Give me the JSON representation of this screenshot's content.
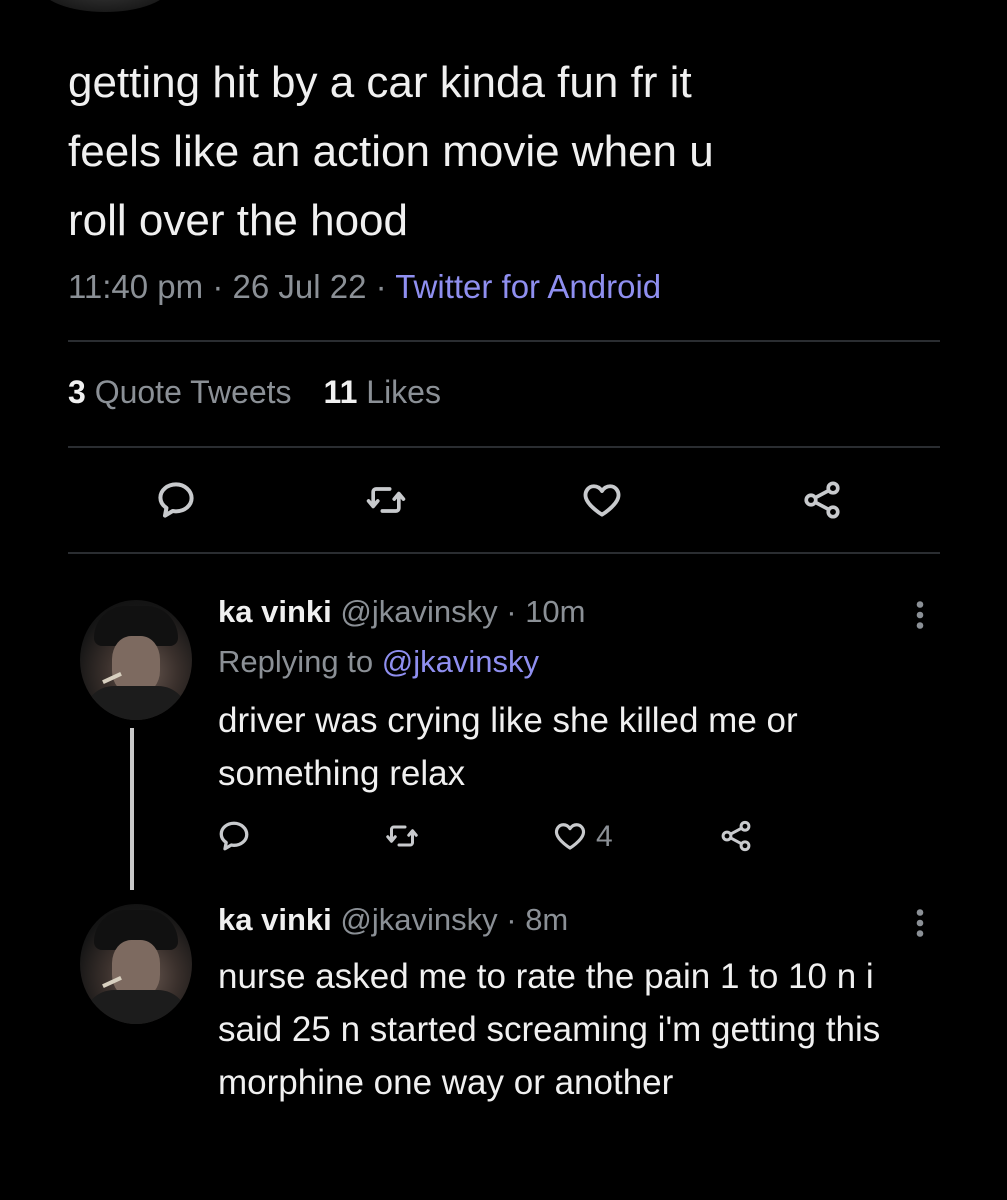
{
  "tweet": {
    "text": "getting hit by a car kinda fun fr it\nfeels like an action movie when u\nroll over the hood",
    "time": "11:40 pm",
    "date": "26 Jul 22",
    "separator": "·",
    "client": "Twitter for Android",
    "stats": {
      "quote_count": "3",
      "quote_label": "Quote Tweets",
      "like_count": "11",
      "like_label": "Likes"
    }
  },
  "replies": [
    {
      "name": "ka vinki",
      "handle": "@jkavinsky",
      "age": "10m",
      "replying_label": "Replying to",
      "replying_to": "@jkavinsky",
      "text": "driver was crying like she killed me or something relax",
      "like_count": "4"
    },
    {
      "name": "ka vinki",
      "handle": "@jkavinsky",
      "age": "8m",
      "text": "nurse asked me to rate the pain 1 to 10 n i said 25 n started screaming i'm getting this morphine one way or another"
    }
  ],
  "icons": {
    "reply": "speech-bubble-icon",
    "retweet": "retweet-icon",
    "like": "heart-icon",
    "share": "share-icon",
    "more": "more-vertical-icon"
  },
  "colors": {
    "background": "#000000",
    "text": "#f0f0f0",
    "muted": "#8b9096",
    "link": "#8f8ff0"
  }
}
